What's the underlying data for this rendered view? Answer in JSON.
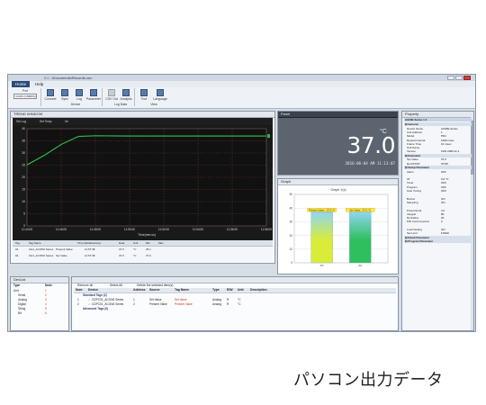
{
  "window": {
    "title": "C:\\...\\Documents\\Records.csv"
  },
  "menu": {
    "home": "Home",
    "help": "Help"
  },
  "ribbon": {
    "port_label": "Port",
    "port_value": "COM3 (USB/RS)",
    "buttons": [
      "Connect",
      "Sync",
      "Log",
      "Parameter",
      "CSV Out",
      "Analysis",
      "Tool",
      "Language"
    ],
    "groups": [
      "Device",
      "Log Data",
      "View"
    ]
  },
  "trend": {
    "title": "TREND WINDOW",
    "legend": [
      "Set Log",
      "Set Temp",
      "Int"
    ],
    "table_headers": [
      "Tag",
      "Tag Name",
      "Time (Relativetime)",
      "Data",
      "Unit",
      "Min",
      "Max"
    ],
    "table_rows": [
      [
        "01",
        "CH1_ACON0 Series",
        "Present Value",
        "11:57:38",
        "37.0",
        "°C",
        "25.1"
      ],
      [
        "02",
        "CH1_ACON0 Series",
        "Set Value",
        "11:57:38",
        "37.0",
        "°C",
        "37.0"
      ]
    ],
    "x_ticks": [
      "11:44:00",
      "11:46:00",
      "11:48:00",
      "11:50:00",
      "11:52:00",
      "11:54:00",
      "11:56:00",
      "11:58:00"
    ],
    "y_ticks": [
      "40",
      "35",
      "30",
      "25",
      "20",
      "15",
      "10",
      "5",
      "0"
    ],
    "x_label": "Time(mm:ss)"
  },
  "chart_data": {
    "type": "line",
    "x": [
      "11:44:00",
      "11:45:00",
      "11:46:00",
      "11:47:00",
      "11:48:00",
      "11:50:00",
      "11:52:00",
      "11:54:00",
      "11:56:00",
      "11:58:00"
    ],
    "series": [
      {
        "name": "Present Value",
        "values": [
          25.1,
          29.0,
          33.5,
          36.8,
          37.1,
          37.0,
          37.0,
          37.0,
          37.0,
          37.0
        ],
        "color": "#2fb34a"
      }
    ],
    "ylim": [
      0,
      40
    ],
    "grid": true
  },
  "panel_meter": {
    "title": "Panel",
    "value": "37.0",
    "unit": "°C",
    "datetime": "2016-06-04 AM 11:13:07"
  },
  "graph": {
    "title": "Graph",
    "header": "Graph 1(s)",
    "bars": [
      {
        "label": "Present Value : 37.0 °C",
        "value": 37.0,
        "color": "#d9ec3a",
        "name": "PV"
      },
      {
        "label": "Set Value : 37.0 °C",
        "value": 37.0,
        "color": "#2fbf5e",
        "name": "SV"
      }
    ],
    "scale_max": 50,
    "ticks": [
      "50",
      "40",
      "30",
      "20",
      "10",
      "0"
    ]
  },
  "property": {
    "title": "Property",
    "device": "AX20E Series 1 2",
    "sections": [
      {
        "name": "General",
        "rows": [
          [
            "Device Name",
            "AX20E Series"
          ],
          [
            "Unit Address",
            "1"
          ],
          [
            "Model",
            "PD1"
          ],
          [
            "Repeat Interval",
            "1000 msec"
          ],
          [
            "Frame Time",
            "10 msec"
          ],
          [
            "Unit Name",
            ""
          ],
          [
            "Version",
            "FW1 2006.11.1"
          ]
        ]
      },
      {
        "name": "Extended",
        "rows": [
          [
            "Set Value",
            "37.0"
          ],
          [
            "Run/STOP",
            "STOP"
          ]
        ]
      },
      {
        "name": "Setup Parameter",
        "rows": [
          [
            "Alarm",
            "OFF"
          ],
          [
            "",
            ""
          ],
          [
            "AT",
            "0.0 °C"
          ],
          [
            "Timer",
            "OFF"
          ],
          [
            "Program",
            "OFF"
          ],
          [
            "Auto Tuning",
            "OFF"
          ],
          [
            "",
            ""
          ],
          [
            "Buzzer",
            "ON"
          ],
          [
            "Sampling",
            "ON"
          ],
          [
            "",
            ""
          ],
          [
            "Proportional",
            "3.0"
          ],
          [
            "Integral",
            "80"
          ],
          [
            "Derivative",
            "20"
          ],
          [
            "PID Control period",
            "2"
          ],
          [
            "",
            ""
          ],
          [
            "Load Setting",
            "ON"
          ],
          [
            "Set Limit",
            "FIXED"
          ]
        ]
      },
      {
        "name": "Detail Parameter",
        "rows": []
      },
      {
        "name": "Program Parameter",
        "rows": []
      }
    ]
  },
  "device_list": {
    "title": "DevList",
    "headers": [
      "Type",
      "Node"
    ],
    "rows": [
      [
        "Unit",
        "1"
      ],
      [
        "Serial",
        "2"
      ],
      [
        "Analog",
        "3"
      ],
      [
        "Digital",
        "4"
      ],
      [
        "String",
        "5"
      ],
      [
        "Bit",
        "6"
      ]
    ]
  },
  "tags": {
    "toolbar": [
      "Remove all",
      "Select All",
      "Delete the selected item(s)"
    ],
    "headers": [
      "Num",
      "Device",
      "Address",
      "Source",
      "Tag Name",
      "Type",
      "R/W",
      "Unit",
      "Description"
    ],
    "groups": [
      "Standard Tags (2)",
      "Advanced Tags (0)"
    ],
    "rows": [
      [
        "1",
        "CDPC01_ACON0 Series",
        "1",
        "Set Value",
        "Set Value",
        "Analog",
        "R",
        "°C",
        ""
      ],
      [
        "2",
        "CDPC01_ACON0 Series",
        "2",
        "Present Value",
        "Present Value",
        "Analog",
        "R",
        "°C",
        ""
      ]
    ]
  },
  "caption": "パソコン出力データ"
}
